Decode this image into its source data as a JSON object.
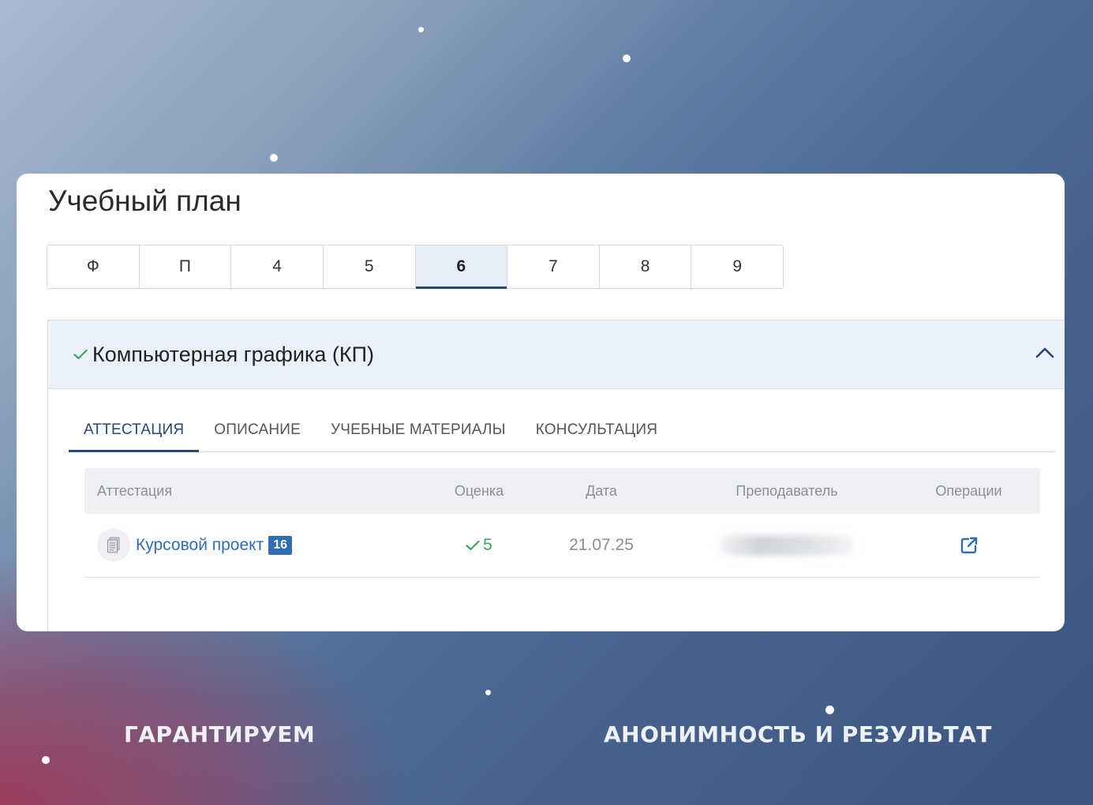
{
  "page": {
    "title": "Учебный план"
  },
  "semesters": {
    "items": [
      "Ф",
      "П",
      "4",
      "5",
      "6",
      "7",
      "8",
      "9"
    ],
    "active": "6"
  },
  "discipline": {
    "title": "Компьютерная графика (КП)",
    "status": "passed"
  },
  "tabs": {
    "items": [
      "АТТЕСТАЦИЯ",
      "ОПИСАНИЕ",
      "УЧЕБНЫЕ МАТЕРИАЛЫ",
      "КОНСУЛЬТАЦИЯ"
    ],
    "active": "АТТЕСТАЦИЯ"
  },
  "table": {
    "headers": {
      "attestation": "Аттестация",
      "grade": "Оценка",
      "date": "Дата",
      "teacher": "Преподаватель",
      "operations": "Операции"
    },
    "rows": [
      {
        "name": "Курсовой проект",
        "hours": "16",
        "grade": "5",
        "date": "21.07.25",
        "teacher_hidden": true,
        "icon": "document-icon",
        "operation_icon": "external-link-icon"
      }
    ]
  },
  "captions": {
    "left": "ГАРАНТИРУЕМ",
    "right": "АНОНИМНОСТЬ И РЕЗУЛЬТАТ"
  },
  "colors": {
    "accent": "#25477a",
    "link": "#2f6db5",
    "success": "#3aa65f",
    "header_bg": "#eaf1fb"
  }
}
